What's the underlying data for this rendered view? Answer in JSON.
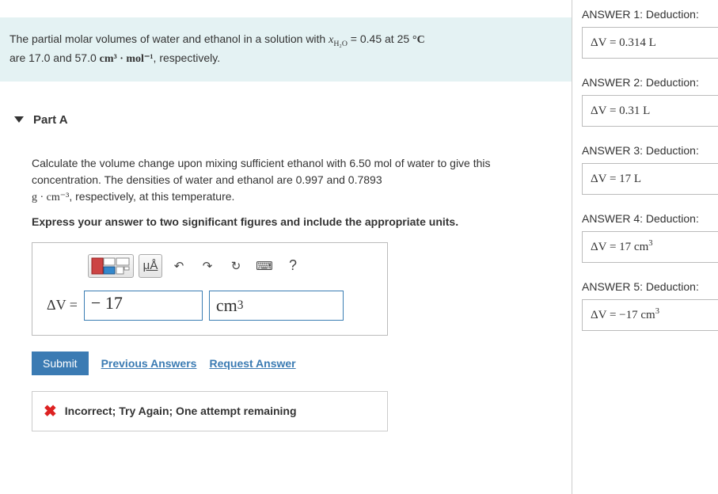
{
  "problem": {
    "text_pre": "The partial molar volumes of water and ethanol in a solution with ",
    "var_xh2o": "x",
    "sub_h2o": "H₂O",
    "eq": " = 0.45 at 25 ",
    "degC": "°C",
    "line2_pre": "are 17.0 and 57.0 ",
    "unit_cm3mol": "cm³ · mol⁻¹",
    "line2_post": ", respectively."
  },
  "partA": {
    "label": "Part A",
    "question_l1": "Calculate the volume change upon mixing sufficient ethanol with 6.50 mol of water to give this concentration. The densities of water and ethanol are 0.997 and 0.7893 ",
    "q_unit": "g · cm⁻³",
    "question_l2": ", respectively, at this temperature.",
    "instruction": "Express your answer to two significant figures and include the appropriate units.",
    "toolbar": {
      "templates_name": "templates-icon",
      "ua_label": "μÅ",
      "undo": "↶",
      "redo": "↷",
      "reset": "↻",
      "keyboard": "⌨",
      "help": "?"
    },
    "input": {
      "lhs": "ΔV =",
      "value": "− 17",
      "unit_base": "cm",
      "unit_exp": "3"
    },
    "submit": "Submit",
    "prev": "Previous Answers",
    "request": "Request Answer",
    "feedback": "Incorrect; Try Again; One attempt remaining"
  },
  "answers": [
    {
      "label": "ANSWER 1: Deduction:",
      "lhs": "ΔV = ",
      "val": "0.314 L",
      "sup": ""
    },
    {
      "label": "ANSWER 2: Deduction:",
      "lhs": "ΔV = ",
      "val": "0.31 L",
      "sup": ""
    },
    {
      "label": "ANSWER 3: Deduction:",
      "lhs": "ΔV = ",
      "val": "17 L",
      "sup": ""
    },
    {
      "label": "ANSWER 4: Deduction:",
      "lhs": "ΔV = ",
      "val": "17 cm",
      "sup": "3"
    },
    {
      "label": "ANSWER 5: Deduction:",
      "lhs": "ΔV = ",
      "val": "−17 cm",
      "sup": "3"
    }
  ]
}
